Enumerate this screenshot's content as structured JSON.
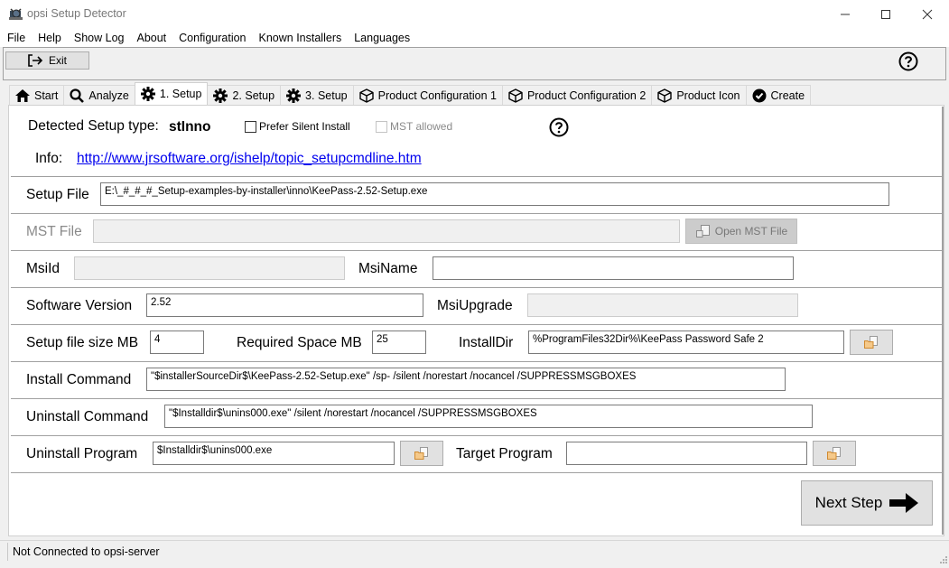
{
  "window": {
    "title": "opsi Setup Detector",
    "controls": {
      "minimize": "minimize",
      "maximize": "maximize",
      "close": "close"
    }
  },
  "menu": [
    "File",
    "Help",
    "Show Log",
    "About",
    "Configuration",
    "Known Installers",
    "Languages"
  ],
  "toolbar": {
    "exit_label": "Exit"
  },
  "tabs": [
    {
      "label": "Start",
      "icon": "home-icon",
      "active": false
    },
    {
      "label": "Analyze",
      "icon": "search-icon",
      "active": false
    },
    {
      "label": "1. Setup",
      "icon": "gear-icon",
      "active": true
    },
    {
      "label": "2. Setup",
      "icon": "gear-icon",
      "active": false
    },
    {
      "label": "3. Setup",
      "icon": "gear-icon",
      "active": false
    },
    {
      "label": "Product Configuration 1",
      "icon": "box-icon",
      "active": false
    },
    {
      "label": "Product Configuration 2",
      "icon": "box-icon",
      "active": false
    },
    {
      "label": "Product Icon",
      "icon": "box-icon",
      "active": false
    },
    {
      "label": "Create",
      "icon": "check-circle-icon",
      "active": false
    }
  ],
  "setup": {
    "detected_label": "Detected Setup type:",
    "detected_value": "stInno",
    "prefer_silent_label": "Prefer Silent Install",
    "prefer_silent_checked": false,
    "mst_allowed_label": "MST allowed",
    "mst_allowed_checked": false,
    "info_label": "Info:",
    "info_link": "http://www.jrsoftware.org/ishelp/topic_setupcmdline.htm",
    "setup_file_label": "Setup File",
    "setup_file_value": "E:\\_#_#_#_Setup-examples-by-installer\\inno\\KeePass-2.52-Setup.exe",
    "mst_file_label": "MST File",
    "mst_file_value": "",
    "open_mst_label": "Open MST File",
    "msiid_label": "MsiId",
    "msiid_value": "",
    "msiname_label": "MsiName",
    "msiname_value": "",
    "software_version_label": "Software Version",
    "software_version_value": "2.52",
    "msiupgrade_label": "MsiUpgrade",
    "msiupgrade_value": "",
    "setup_size_label": "Setup file size MB",
    "setup_size_value": "4",
    "required_space_label": "Required Space MB",
    "required_space_value": "25",
    "installdir_label": "InstallDir",
    "installdir_value": "%ProgramFiles32Dir%\\KeePass Password Safe 2",
    "install_cmd_label": "Install Command",
    "install_cmd_value": "\"$installerSourceDir$\\KeePass-2.52-Setup.exe\" /sp- /silent /norestart /nocancel /SUPPRESSMSGBOXES",
    "uninstall_cmd_label": "Uninstall Command",
    "uninstall_cmd_value": "\"$Installdir$\\unins000.exe\" /silent /norestart /nocancel /SUPPRESSMSGBOXES",
    "uninstall_prog_label": "Uninstall Program",
    "uninstall_prog_value": "$Installdir$\\unins000.exe",
    "target_prog_label": "Target Program",
    "target_prog_value": "",
    "next_step_label": "Next Step"
  },
  "status": {
    "text": "Not Connected to opsi-server"
  }
}
